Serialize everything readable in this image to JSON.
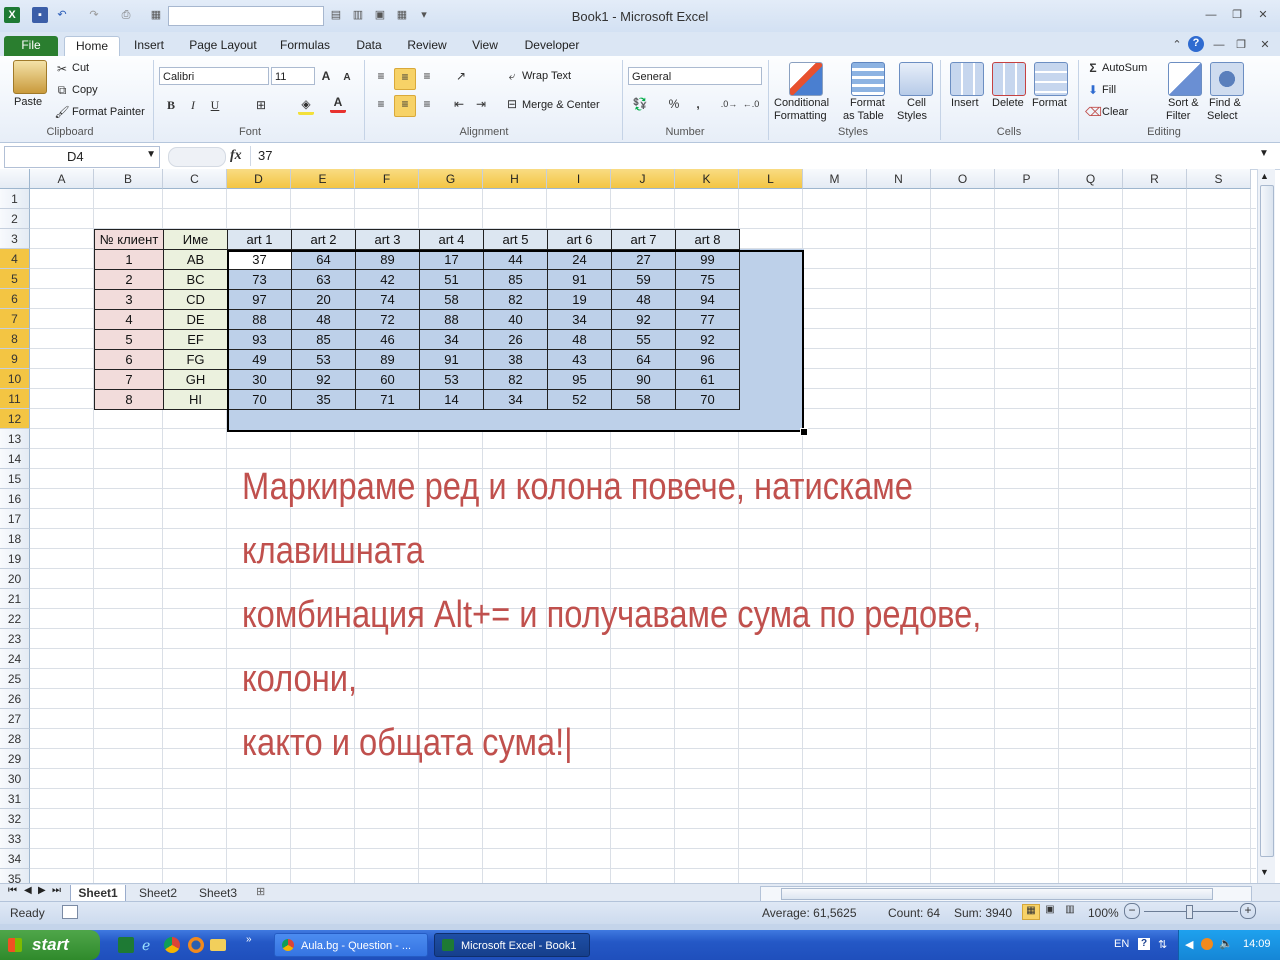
{
  "window": {
    "title": "Book1 - Microsoft Excel"
  },
  "tabs": [
    "File",
    "Home",
    "Insert",
    "Page Layout",
    "Formulas",
    "Data",
    "Review",
    "View",
    "Developer"
  ],
  "ribbon": {
    "clipboard": {
      "paste": "Paste",
      "cut": "Cut",
      "copy": "Copy",
      "format_painter": "Format Painter",
      "label": "Clipboard"
    },
    "font": {
      "name": "Calibri",
      "size": "11",
      "label": "Font",
      "bold": "B",
      "italic": "I",
      "underline": "U"
    },
    "alignment": {
      "wrap": "Wrap Text",
      "merge": "Merge & Center",
      "label": "Alignment"
    },
    "number": {
      "format": "General",
      "percent": "%",
      "comma": ",",
      "label": "Number"
    },
    "styles": {
      "conditional": "Conditional",
      "conditional2": "Formatting",
      "format_table": "Format",
      "format_table2": "as Table",
      "cell_styles": "Cell",
      "cell_styles2": "Styles",
      "label": "Styles"
    },
    "cells": {
      "insert": "Insert",
      "delete": "Delete",
      "format": "Format",
      "label": "Cells"
    },
    "editing": {
      "autosum": "AutoSum",
      "fill": "Fill",
      "clear": "Clear",
      "sort": "Sort &",
      "sort2": "Filter",
      "find": "Find &",
      "find2": "Select",
      "label": "Editing"
    }
  },
  "formula_bar": {
    "name_box": "D4",
    "fx": "fx",
    "value": "37"
  },
  "columns": [
    "A",
    "B",
    "C",
    "D",
    "E",
    "F",
    "G",
    "H",
    "I",
    "J",
    "K",
    "L",
    "M",
    "N",
    "O",
    "P",
    "Q",
    "R",
    "S"
  ],
  "rows": [
    "1",
    "2",
    "3",
    "4",
    "5",
    "6",
    "7",
    "8",
    "9",
    "10",
    "11",
    "12",
    "13",
    "14",
    "15",
    "16",
    "17",
    "18",
    "19",
    "20",
    "21",
    "22",
    "23",
    "24",
    "25",
    "26",
    "27",
    "28",
    "29",
    "30",
    "31",
    "32",
    "33",
    "34",
    "35"
  ],
  "table": {
    "header_client": "№ клиент",
    "header_name": "Име",
    "headers": [
      "art 1",
      "art 2",
      "art 3",
      "art 4",
      "art 5",
      "art 6",
      "art 7",
      "art 8"
    ],
    "clients": [
      "1",
      "2",
      "3",
      "4",
      "5",
      "6",
      "7",
      "8"
    ],
    "names": [
      "AB",
      "BC",
      "CD",
      "DE",
      "EF",
      "FG",
      "GH",
      "HI"
    ],
    "values": [
      [
        "37",
        "64",
        "89",
        "17",
        "44",
        "24",
        "27",
        "99"
      ],
      [
        "73",
        "63",
        "42",
        "51",
        "85",
        "91",
        "59",
        "75"
      ],
      [
        "97",
        "20",
        "74",
        "58",
        "82",
        "19",
        "48",
        "94"
      ],
      [
        "88",
        "48",
        "72",
        "88",
        "40",
        "34",
        "92",
        "77"
      ],
      [
        "93",
        "85",
        "46",
        "34",
        "26",
        "48",
        "55",
        "92"
      ],
      [
        "49",
        "53",
        "89",
        "91",
        "38",
        "43",
        "64",
        "96"
      ],
      [
        "30",
        "92",
        "60",
        "53",
        "82",
        "95",
        "90",
        "61"
      ],
      [
        "70",
        "35",
        "71",
        "14",
        "34",
        "52",
        "58",
        "70"
      ]
    ]
  },
  "note": {
    "line1": "Маркираме ред и колона повече, натискаме клавишната",
    "line2": "комбинация Alt+= и получаваме сума по редове, колони,",
    "line3": "както и общата сума!|"
  },
  "sheets": [
    "Sheet1",
    "Sheet2",
    "Sheet3"
  ],
  "status": {
    "ready": "Ready",
    "average": "Average: 61,5625",
    "count": "Count: 64",
    "sum": "Sum: 3940",
    "zoom": "100%"
  },
  "taskbar": {
    "start": "start",
    "tasks": [
      "Aula.bg - Question - ...",
      "Microsoft Excel - Book1"
    ],
    "lang": "EN",
    "clock": "14:09"
  },
  "colors": {
    "accent": "#c0504d",
    "selection": "#bdd0e9",
    "client_fill": "#f2dcdb",
    "name_fill": "#ebf1de",
    "header_fill": "#dce6f1"
  }
}
